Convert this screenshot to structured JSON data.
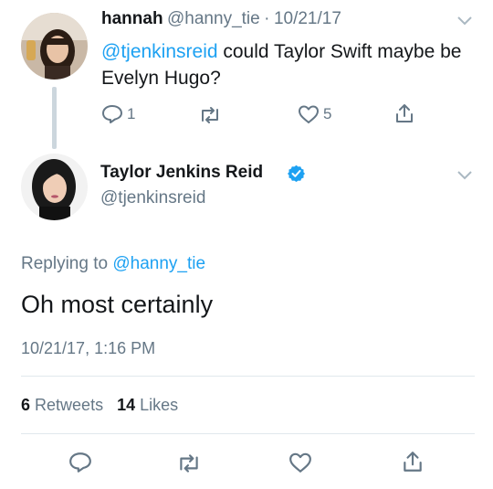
{
  "parent_tweet": {
    "display_name": "hannah",
    "handle": "@hanny_tie",
    "separator": "·",
    "date": "10/21/17",
    "mention": "@tjenkinsreid",
    "text": " could Taylor Swift maybe be Evelyn Hugo?",
    "reply_count": "1",
    "retweet_count": "",
    "like_count": "5"
  },
  "main_tweet": {
    "display_name": "Taylor Jenkins Reid",
    "handle": "@tjenkinsreid",
    "verified": true,
    "replying_prefix": "Replying to ",
    "replying_handle": "@hanny_tie",
    "text": "Oh most certainly",
    "timestamp": "10/21/17, 1:16 PM",
    "retweets_num": "6",
    "retweets_label": "Retweets",
    "likes_num": "14",
    "likes_label": "Likes"
  },
  "colors": {
    "accent": "#1da1f2",
    "muted": "#657786",
    "divider": "#e1e8ed"
  },
  "icons": [
    "reply-icon",
    "retweet-icon",
    "like-icon",
    "share-icon",
    "chevron-down-icon",
    "verified-badge-icon"
  ]
}
